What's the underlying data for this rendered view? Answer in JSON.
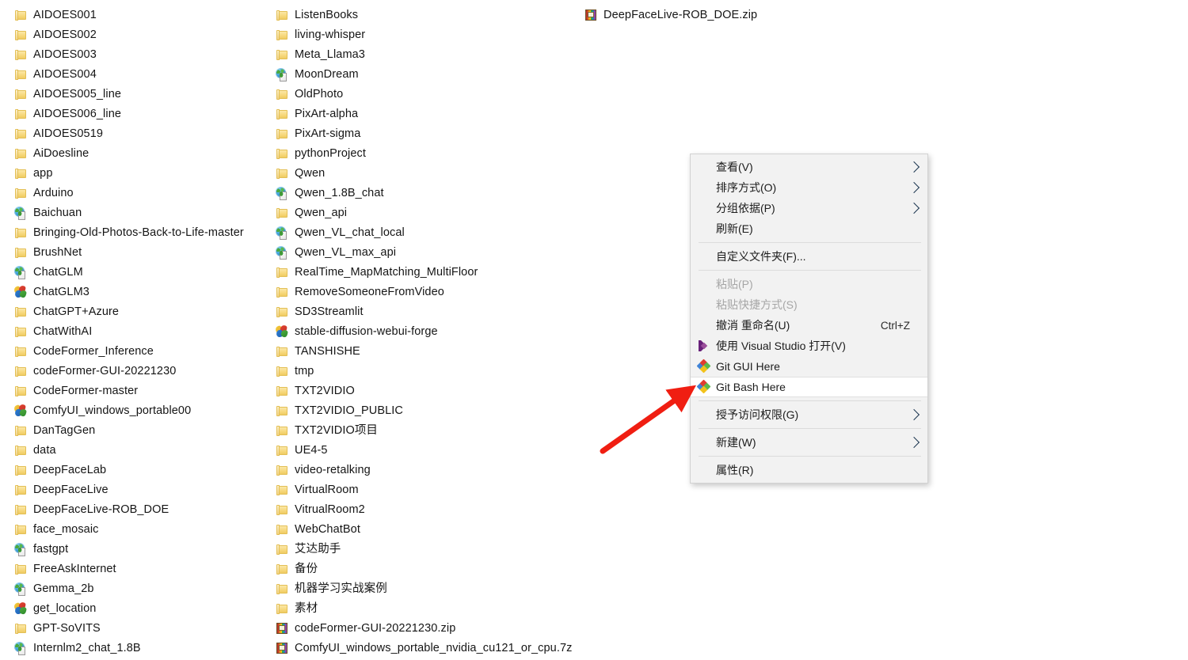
{
  "window": {
    "kind": "windows-file-explorer-folder-contents",
    "background_color": "#ffffff"
  },
  "file_list": {
    "columns": [
      {
        "name": "column-1",
        "items": [
          {
            "label": "AIDOES001",
            "icon": "folder-icon"
          },
          {
            "label": "AIDOES002",
            "icon": "folder-icon"
          },
          {
            "label": "AIDOES003",
            "icon": "folder-icon"
          },
          {
            "label": "AIDOES004",
            "icon": "folder-icon"
          },
          {
            "label": "AIDOES005_line",
            "icon": "folder-icon"
          },
          {
            "label": "AIDOES006_line",
            "icon": "folder-icon"
          },
          {
            "label": "AIDOES0519",
            "icon": "folder-icon"
          },
          {
            "label": "AiDoesline",
            "icon": "folder-icon"
          },
          {
            "label": "app",
            "icon": "folder-icon"
          },
          {
            "label": "Arduino",
            "icon": "folder-icon"
          },
          {
            "label": "Baichuan",
            "icon": "globe-icon"
          },
          {
            "label": "Bringing-Old-Photos-Back-to-Life-master",
            "icon": "folder-icon"
          },
          {
            "label": "BrushNet",
            "icon": "folder-icon"
          },
          {
            "label": "ChatGLM",
            "icon": "globe-icon"
          },
          {
            "label": "ChatGLM3",
            "icon": "butterfly-icon"
          },
          {
            "label": "ChatGPT+Azure",
            "icon": "folder-icon"
          },
          {
            "label": "ChatWithAI",
            "icon": "folder-icon"
          },
          {
            "label": "CodeFormer_Inference",
            "icon": "folder-icon"
          },
          {
            "label": "codeFormer-GUI-20221230",
            "icon": "folder-icon"
          },
          {
            "label": "CodeFormer-master",
            "icon": "folder-icon"
          },
          {
            "label": "ComfyUI_windows_portable00",
            "icon": "butterfly-icon"
          },
          {
            "label": "DanTagGen",
            "icon": "folder-icon"
          },
          {
            "label": "data",
            "icon": "folder-icon"
          },
          {
            "label": "DeepFaceLab",
            "icon": "folder-icon"
          },
          {
            "label": "DeepFaceLive",
            "icon": "folder-icon"
          },
          {
            "label": "DeepFaceLive-ROB_DOE",
            "icon": "folder-icon"
          },
          {
            "label": "face_mosaic",
            "icon": "folder-icon"
          },
          {
            "label": "fastgpt",
            "icon": "globe-icon"
          },
          {
            "label": "FreeAskInternet",
            "icon": "folder-icon"
          },
          {
            "label": "Gemma_2b",
            "icon": "globe-icon"
          },
          {
            "label": "get_location",
            "icon": "butterfly-icon"
          },
          {
            "label": "GPT-SoVITS",
            "icon": "folder-icon"
          },
          {
            "label": "Internlm2_chat_1.8B",
            "icon": "globe-icon"
          }
        ]
      },
      {
        "name": "column-2",
        "items": [
          {
            "label": "ListenBooks",
            "icon": "folder-icon"
          },
          {
            "label": "living-whisper",
            "icon": "folder-icon"
          },
          {
            "label": "Meta_Llama3",
            "icon": "folder-icon"
          },
          {
            "label": "MoonDream",
            "icon": "globe-icon"
          },
          {
            "label": "OldPhoto",
            "icon": "folder-icon"
          },
          {
            "label": "PixArt-alpha",
            "icon": "folder-icon"
          },
          {
            "label": "PixArt-sigma",
            "icon": "folder-icon"
          },
          {
            "label": "pythonProject",
            "icon": "folder-icon"
          },
          {
            "label": "Qwen",
            "icon": "folder-icon"
          },
          {
            "label": "Qwen_1.8B_chat",
            "icon": "globe-icon"
          },
          {
            "label": "Qwen_api",
            "icon": "folder-icon"
          },
          {
            "label": "Qwen_VL_chat_local",
            "icon": "globe-icon"
          },
          {
            "label": "Qwen_VL_max_api",
            "icon": "globe-icon"
          },
          {
            "label": "RealTime_MapMatching_MultiFloor",
            "icon": "folder-icon"
          },
          {
            "label": "RemoveSomeoneFromVideo",
            "icon": "folder-icon"
          },
          {
            "label": "SD3Streamlit",
            "icon": "folder-icon"
          },
          {
            "label": "stable-diffusion-webui-forge",
            "icon": "butterfly-icon"
          },
          {
            "label": "TANSHISHE",
            "icon": "folder-icon"
          },
          {
            "label": "tmp",
            "icon": "folder-icon"
          },
          {
            "label": "TXT2VIDIO",
            "icon": "folder-icon"
          },
          {
            "label": "TXT2VIDIO_PUBLIC",
            "icon": "folder-icon"
          },
          {
            "label": "TXT2VIDIO项目",
            "icon": "folder-icon"
          },
          {
            "label": "UE4-5",
            "icon": "folder-icon"
          },
          {
            "label": "video-retalking",
            "icon": "folder-icon"
          },
          {
            "label": "VirtualRoom",
            "icon": "folder-icon"
          },
          {
            "label": "VitrualRoom2",
            "icon": "folder-icon"
          },
          {
            "label": "WebChatBot",
            "icon": "folder-icon"
          },
          {
            "label": "艾达助手",
            "icon": "folder-icon"
          },
          {
            "label": "备份",
            "icon": "folder-icon"
          },
          {
            "label": "机器学习实战案例",
            "icon": "folder-icon"
          },
          {
            "label": "素材",
            "icon": "folder-icon"
          },
          {
            "label": "codeFormer-GUI-20221230.zip",
            "icon": "archive-icon"
          },
          {
            "label": "ComfyUI_windows_portable_nvidia_cu121_or_cpu.7z",
            "icon": "archive-icon"
          }
        ]
      },
      {
        "name": "column-3",
        "items": [
          {
            "label": "DeepFaceLive-ROB_DOE.zip",
            "icon": "archive-icon"
          }
        ]
      }
    ]
  },
  "context_menu": {
    "background_color": "#f2f2f2",
    "highlight_color": "#ffffff",
    "items": [
      {
        "label": "查看(V)",
        "icon": "none",
        "submenu": true,
        "accel": "",
        "disabled": false,
        "highlighted": false
      },
      {
        "label": "排序方式(O)",
        "icon": "none",
        "submenu": true,
        "accel": "",
        "disabled": false,
        "highlighted": false
      },
      {
        "label": "分组依据(P)",
        "icon": "none",
        "submenu": true,
        "accel": "",
        "disabled": false,
        "highlighted": false
      },
      {
        "label": "刷新(E)",
        "icon": "none",
        "submenu": false,
        "accel": "",
        "disabled": false,
        "highlighted": false
      },
      {
        "separator": true
      },
      {
        "label": "自定义文件夹(F)...",
        "icon": "none",
        "submenu": false,
        "accel": "",
        "disabled": false,
        "highlighted": false
      },
      {
        "separator": true
      },
      {
        "label": "粘贴(P)",
        "icon": "none",
        "submenu": false,
        "accel": "",
        "disabled": true,
        "highlighted": false
      },
      {
        "label": "粘贴快捷方式(S)",
        "icon": "none",
        "submenu": false,
        "accel": "",
        "disabled": true,
        "highlighted": false
      },
      {
        "label": "撤消 重命名(U)",
        "icon": "none",
        "submenu": false,
        "accel": "Ctrl+Z",
        "disabled": false,
        "highlighted": false
      },
      {
        "label": "使用 Visual Studio 打开(V)",
        "icon": "visual-studio-icon",
        "submenu": false,
        "accel": "",
        "disabled": false,
        "highlighted": false
      },
      {
        "label": "Git GUI Here",
        "icon": "git-icon",
        "submenu": false,
        "accel": "",
        "disabled": false,
        "highlighted": false
      },
      {
        "label": "Git Bash Here",
        "icon": "git-icon",
        "submenu": false,
        "accel": "",
        "disabled": false,
        "highlighted": true
      },
      {
        "separator": true
      },
      {
        "label": "授予访问权限(G)",
        "icon": "none",
        "submenu": true,
        "accel": "",
        "disabled": false,
        "highlighted": false
      },
      {
        "separator": true
      },
      {
        "label": "新建(W)",
        "icon": "none",
        "submenu": true,
        "accel": "",
        "disabled": false,
        "highlighted": false
      },
      {
        "separator": true
      },
      {
        "label": "属性(R)",
        "icon": "none",
        "submenu": false,
        "accel": "",
        "disabled": false,
        "highlighted": false
      }
    ]
  },
  "annotation": {
    "arrow": {
      "name": "red-pointer-arrow",
      "color": "#f01e12",
      "points_to": "Git Bash Here"
    }
  }
}
